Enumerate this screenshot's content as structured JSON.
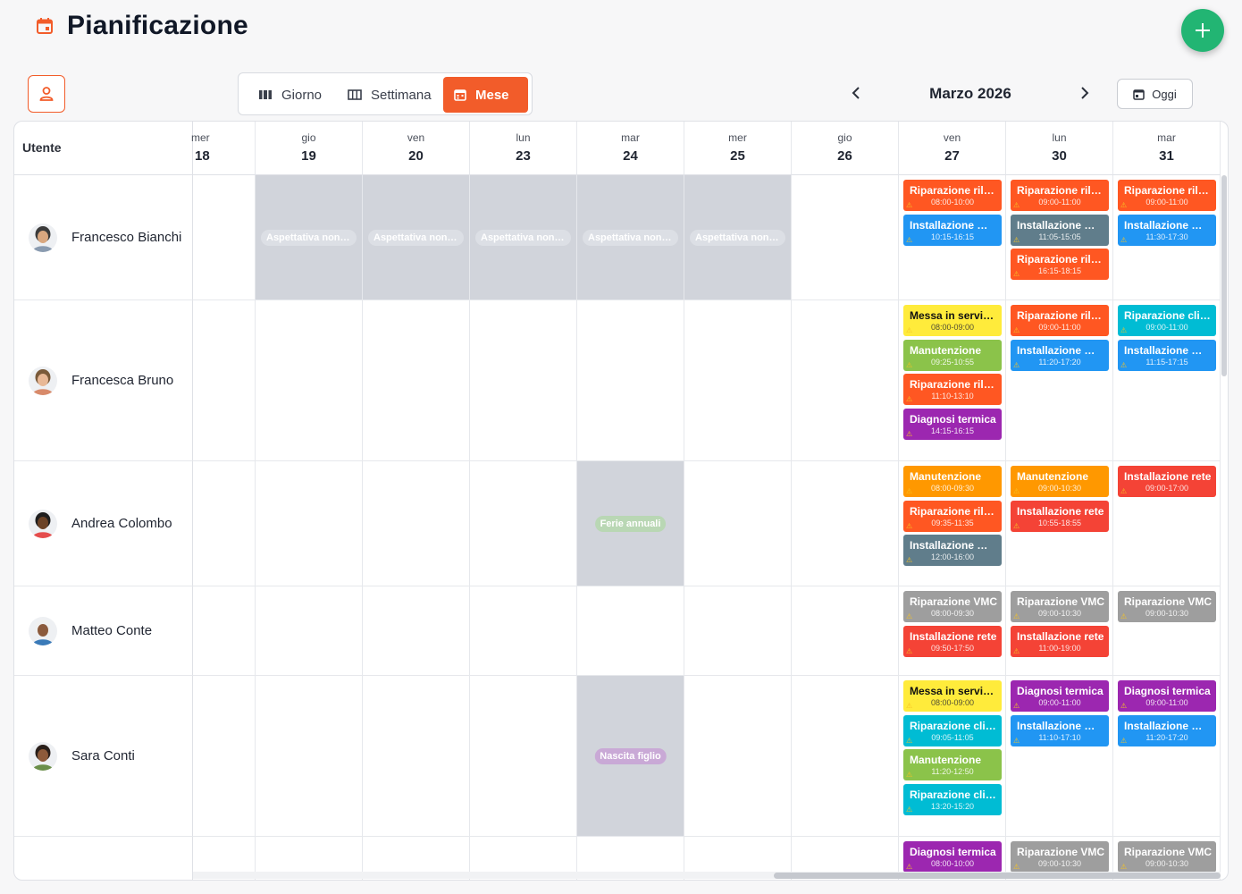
{
  "header": {
    "title": "Pianificazione"
  },
  "colors": {
    "accent": "#f25c2a",
    "fab": "#22b573"
  },
  "toolbar": {
    "views": [
      {
        "label": "Giorno",
        "icon": "view-day-icon",
        "active": false
      },
      {
        "label": "Settimana",
        "icon": "view-week-icon",
        "active": false
      },
      {
        "label": "Mese",
        "icon": "calendar-month-icon",
        "active": true
      }
    ],
    "month_label": "Marzo 2026",
    "today_label": "Oggi"
  },
  "calendar": {
    "user_header": "Utente",
    "days": [
      {
        "dow": "mer",
        "num": "18"
      },
      {
        "dow": "gio",
        "num": "19"
      },
      {
        "dow": "ven",
        "num": "20"
      },
      {
        "dow": "lun",
        "num": "23"
      },
      {
        "dow": "mar",
        "num": "24"
      },
      {
        "dow": "mer",
        "num": "25"
      },
      {
        "dow": "gio",
        "num": "26"
      },
      {
        "dow": "ven",
        "num": "27"
      },
      {
        "dow": "lun",
        "num": "30"
      },
      {
        "dow": "mar",
        "num": "31"
      }
    ],
    "users": [
      {
        "name": "Francesco Bianchi",
        "absences": [
          {
            "day": 1,
            "label": "Aspettativa non retribuita"
          },
          {
            "day": 2,
            "label": "Aspettativa non retribuita"
          },
          {
            "day": 3,
            "label": "Aspettativa non retribuita"
          },
          {
            "day": 4,
            "label": "Aspettativa non retribuita"
          },
          {
            "day": 5,
            "label": "Aspettativa non retribuita"
          }
        ],
        "events": [
          {
            "day": 7,
            "title": "Riparazione rilevatore",
            "time": "08:00-10:00",
            "color": "#ff5722"
          },
          {
            "day": 7,
            "title": "Installazione …",
            "time": "10:15-16:15",
            "color": "#2196f3"
          },
          {
            "day": 8,
            "title": "Riparazione rilevatore",
            "time": "09:00-11:00",
            "color": "#ff5722"
          },
          {
            "day": 8,
            "title": "Installazione …",
            "time": "11:05-15:05",
            "color": "#607d8b"
          },
          {
            "day": 8,
            "title": "Riparazione rilevatore",
            "time": "16:15-18:15",
            "color": "#ff5722"
          },
          {
            "day": 9,
            "title": "Riparazione rilevatore",
            "time": "09:00-11:00",
            "color": "#ff5722"
          },
          {
            "day": 9,
            "title": "Installazione …",
            "time": "11:30-17:30",
            "color": "#2196f3"
          }
        ]
      },
      {
        "name": "Francesca Bruno",
        "absences": [],
        "events": [
          {
            "day": 7,
            "title": "Messa in servizio",
            "time": "08:00-09:00",
            "color": "#ffeb3b",
            "dark": true
          },
          {
            "day": 7,
            "title": "Manutenzione",
            "time": "09:25-10:55",
            "color": "#8bc34a"
          },
          {
            "day": 7,
            "title": "Riparazione rilevatore",
            "time": "11:10-13:10",
            "color": "#ff5722"
          },
          {
            "day": 7,
            "title": "Diagnosi termica",
            "time": "14:15-16:15",
            "color": "#9c27b0"
          },
          {
            "day": 8,
            "title": "Riparazione rilevatore",
            "time": "09:00-11:00",
            "color": "#ff5722"
          },
          {
            "day": 8,
            "title": "Installazione …",
            "time": "11:20-17:20",
            "color": "#2196f3"
          },
          {
            "day": 9,
            "title": "Riparazione climatizzatore",
            "time": "09:00-11:00",
            "color": "#00bcd4"
          },
          {
            "day": 9,
            "title": "Installazione …",
            "time": "11:15-17:15",
            "color": "#2196f3"
          }
        ]
      },
      {
        "name": "Andrea Colombo",
        "absences": [
          {
            "day": 4,
            "label": "Ferie annuali",
            "pill_color": "#b9d7b4"
          }
        ],
        "events": [
          {
            "day": 7,
            "title": "Manutenzione",
            "time": "08:00-09:30",
            "color": "#ff9800"
          },
          {
            "day": 7,
            "title": "Riparazione rilevatore",
            "time": "09:35-11:35",
            "color": "#ff5722"
          },
          {
            "day": 7,
            "title": "Installazione …",
            "time": "12:00-16:00",
            "color": "#607d8b"
          },
          {
            "day": 8,
            "title": "Manutenzione",
            "time": "09:00-10:30",
            "color": "#ff9800"
          },
          {
            "day": 8,
            "title": "Installazione rete",
            "time": "10:55-18:55",
            "color": "#f44336"
          },
          {
            "day": 9,
            "title": "Installazione rete",
            "time": "09:00-17:00",
            "color": "#f44336"
          }
        ]
      },
      {
        "name": "Matteo Conte",
        "absences": [],
        "events": [
          {
            "day": 7,
            "title": "Riparazione VMC",
            "time": "08:00-09:30",
            "color": "#9e9e9e"
          },
          {
            "day": 7,
            "title": "Installazione rete",
            "time": "09:50-17:50",
            "color": "#f44336"
          },
          {
            "day": 8,
            "title": "Riparazione VMC",
            "time": "09:00-10:30",
            "color": "#9e9e9e"
          },
          {
            "day": 8,
            "title": "Installazione rete",
            "time": "11:00-19:00",
            "color": "#f44336"
          },
          {
            "day": 9,
            "title": "Riparazione VMC",
            "time": "09:00-10:30",
            "color": "#9e9e9e"
          }
        ]
      },
      {
        "name": "Sara Conti",
        "absences": [
          {
            "day": 4,
            "label": "Nascita figlio",
            "pill_color": "#c9a9d6"
          }
        ],
        "events": [
          {
            "day": 7,
            "title": "Messa in servizio",
            "time": "08:00-09:00",
            "color": "#ffeb3b",
            "dark": true
          },
          {
            "day": 7,
            "title": "Riparazione climatizzatore",
            "time": "09:05-11:05",
            "color": "#00bcd4"
          },
          {
            "day": 7,
            "title": "Manutenzione",
            "time": "11:20-12:50",
            "color": "#8bc34a"
          },
          {
            "day": 7,
            "title": "Riparazione climatizzatore",
            "time": "13:20-15:20",
            "color": "#00bcd4"
          },
          {
            "day": 8,
            "title": "Diagnosi termica",
            "time": "09:00-11:00",
            "color": "#9c27b0"
          },
          {
            "day": 8,
            "title": "Installazione …",
            "time": "11:10-17:10",
            "color": "#2196f3"
          },
          {
            "day": 9,
            "title": "Diagnosi termica",
            "time": "09:00-11:00",
            "color": "#9c27b0"
          },
          {
            "day": 9,
            "title": "Installazione …",
            "time": "11:20-17:20",
            "color": "#2196f3"
          }
        ]
      },
      {
        "name": "",
        "absences": [],
        "events": [
          {
            "day": 7,
            "title": "Diagnosi termica",
            "time": "08:00-10:00",
            "color": "#9c27b0"
          },
          {
            "day": 8,
            "title": "Riparazione VMC",
            "time": "09:00-10:30",
            "color": "#9e9e9e"
          },
          {
            "day": 9,
            "title": "Riparazione VMC",
            "time": "09:00-10:30",
            "color": "#9e9e9e"
          }
        ]
      }
    ]
  }
}
